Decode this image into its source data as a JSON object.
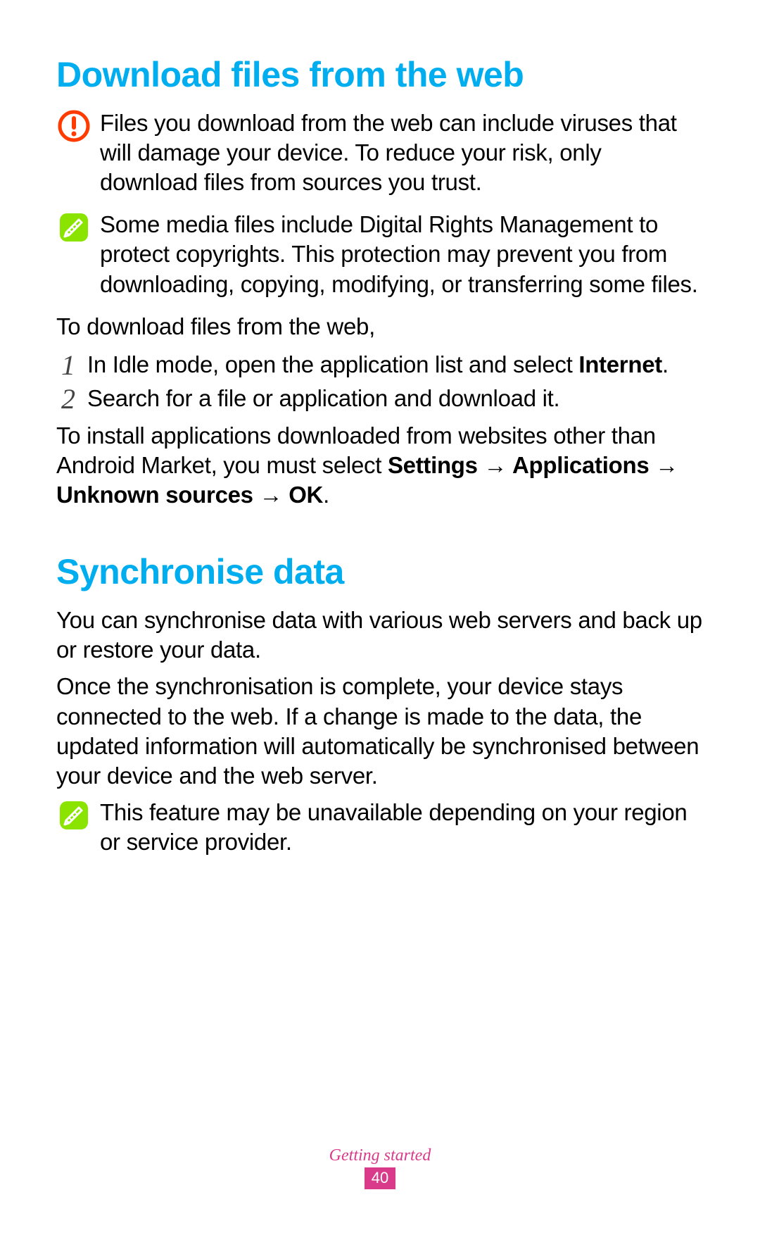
{
  "section1": {
    "title": "Download files from the web",
    "warning": "Files you download from the web can include viruses that will damage your device. To reduce your risk, only download files from sources you trust.",
    "note": "Some media files include Digital Rights Management to protect copyrights. This protection may prevent you from downloading, copying, modifying, or transferring some files.",
    "lead": "To download files from the web,",
    "step1_pre": "In Idle mode, open the application list and select ",
    "step1_bold": "Internet",
    "step1_post": ".",
    "step2": "Search for a file or application and download it.",
    "install_pre": "To install applications downloaded from websites other than Android Market, you must select ",
    "install_b1": "Settings",
    "install_b2": "Applications",
    "install_b3": "Unknown sources",
    "install_b4": "OK",
    "install_post": ".",
    "num1": "1",
    "num2": "2",
    "arrow": "→"
  },
  "section2": {
    "title": "Synchronise data",
    "p1": "You can synchronise data with various web servers and back up or restore your data.",
    "p2": "Once the synchronisation is complete, your device stays connected to the web. If a change is made to the data, the updated information will automatically be synchronised between your device and the web server.",
    "note": "This feature may be unavailable depending on your region or service provider."
  },
  "footer": {
    "chapter": "Getting started",
    "page": "40"
  }
}
